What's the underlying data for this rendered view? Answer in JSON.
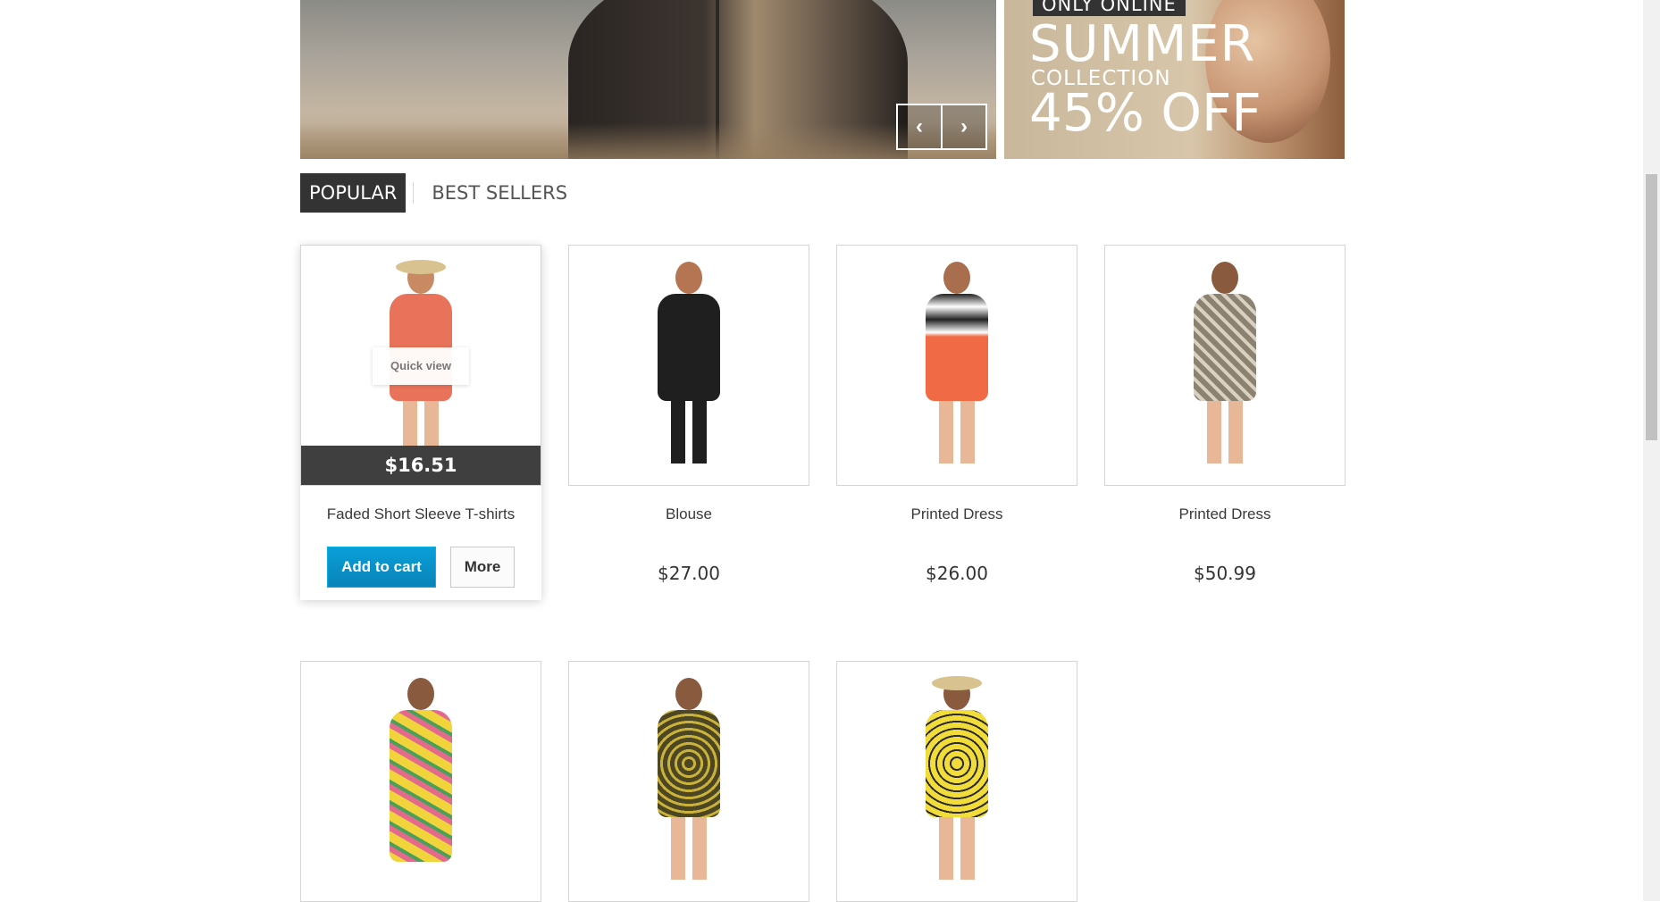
{
  "promo": {
    "tag": "ONLY ONLINE",
    "line1": "SUMMER",
    "line2": "COLLECTION",
    "line3": "45% OFF"
  },
  "slider": {
    "prev_icon": "chevron-left-icon",
    "next_icon": "chevron-right-icon",
    "prev_glyph": "‹",
    "next_glyph": "›"
  },
  "tabs": [
    {
      "label": "POPULAR",
      "active": true
    },
    {
      "label": "BEST SELLERS",
      "active": false
    }
  ],
  "products": [
    {
      "name": "Faded Short Sleeve T-shirts",
      "price": "$16.51",
      "quick_view": "Quick view",
      "add_to_cart": "Add to cart",
      "more": "More",
      "hovered": true,
      "outfit_color": "#e8725a"
    },
    {
      "name": "Blouse",
      "price": "$27.00",
      "outfit_color": "#1f1f1f"
    },
    {
      "name": "Printed Dress",
      "price": "$26.00",
      "outfit_color": "#f06b45"
    },
    {
      "name": "Printed Dress",
      "price": "$50.99",
      "outfit_color": "#8c8271"
    },
    {
      "outfit_color": "#f1d33c"
    },
    {
      "outfit_color": "#4d4622"
    },
    {
      "outfit_color": "#f1dc3a"
    }
  ],
  "colors": {
    "accent_blue": "#0a9fd8",
    "tab_active": "#333333"
  }
}
